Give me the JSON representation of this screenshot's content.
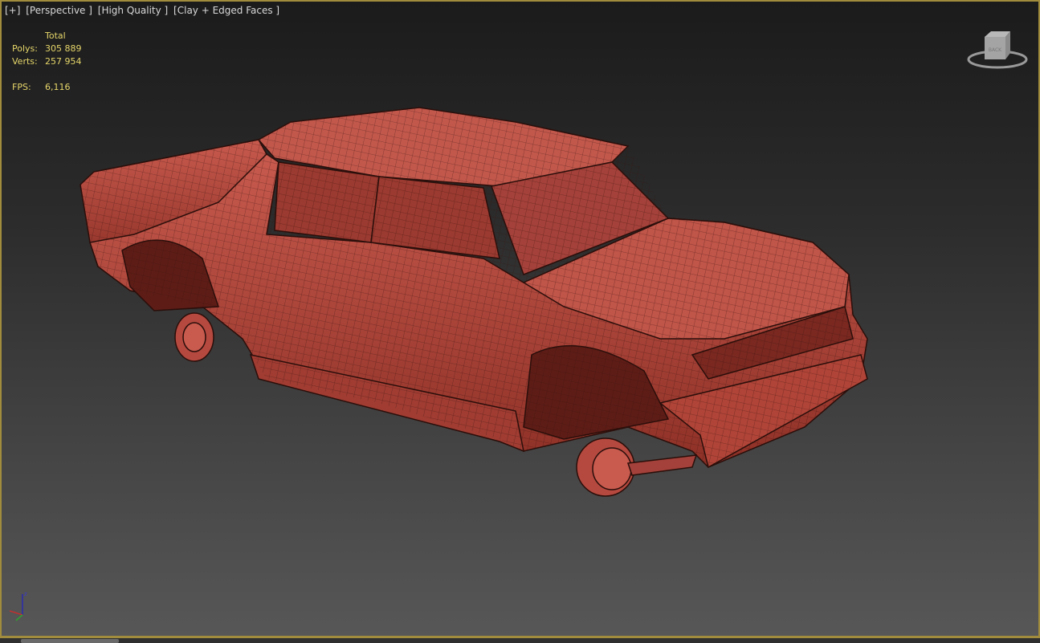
{
  "viewport": {
    "labels": [
      "[+]",
      "[Perspective ]",
      "[High Quality ]",
      "[Clay + Edged Faces ]"
    ],
    "stats": {
      "header": "Total",
      "polys_label": "Polys:",
      "polys": "305 889",
      "verts_label": "Verts:",
      "verts": "257 954",
      "fps_label": "FPS:",
      "fps": "6,116"
    },
    "viewcube_face": "BACK",
    "gizmo_axis_label": "z",
    "colors": {
      "border": "#a08c3c",
      "stats_text": "#e6d66a",
      "clay": "#b5493f",
      "edges": "#3a1410"
    }
  }
}
